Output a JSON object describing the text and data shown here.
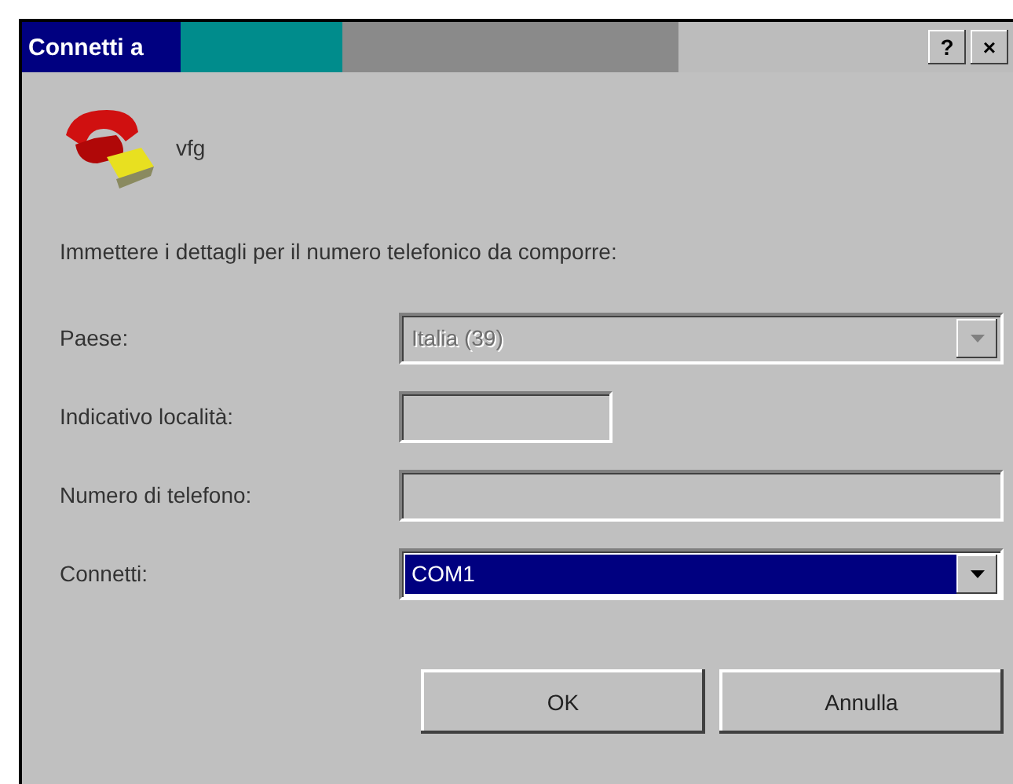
{
  "window": {
    "title": "Connetti a",
    "help_button": "?",
    "close_button": "×"
  },
  "connection": {
    "name": "vfg"
  },
  "instruction": "Immettere i dettagli per il numero telefonico da comporre:",
  "fields": [
    {
      "kind": "combo",
      "label": "Paese:",
      "value": "Italia (39)",
      "disabled": true,
      "selected": false
    },
    {
      "kind": "text",
      "label": "Indicativo località:",
      "disabled": true,
      "selected": false
    },
    {
      "kind": "text",
      "label": "Numero di telefono:",
      "disabled": true,
      "selected": false
    },
    {
      "kind": "combo",
      "label": "Connetti:",
      "value": "COM1",
      "disabled": false,
      "selected": true
    }
  ],
  "buttons": [
    "OK",
    "Annulla"
  ]
}
